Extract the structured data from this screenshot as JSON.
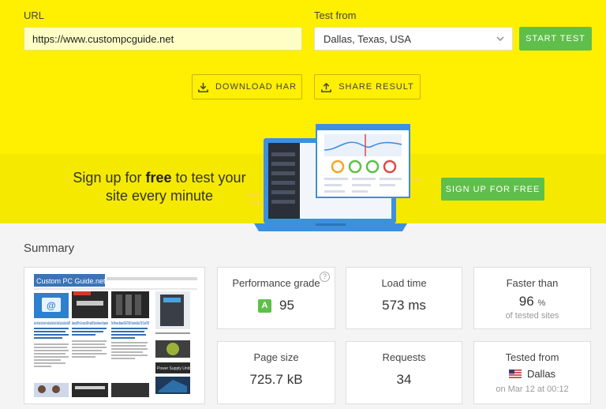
{
  "form": {
    "url_label": "URL",
    "url_value": "https://www.custompcguide.net",
    "test_from_label": "Test from",
    "test_from_value": "Dallas, Texas, USA",
    "start_label": "START TEST",
    "download_label": "DOWNLOAD HAR",
    "share_label": "SHARE RESULT"
  },
  "banner": {
    "text_before": "Sign up for ",
    "text_bold": "free",
    "text_after": " to test your site every minute",
    "button_label": "SIGN UP FOR FREE"
  },
  "summary": {
    "title": "Summary",
    "thumbnail": {
      "site_title": "Custom PC Guide.net",
      "headline_1": "Setup Your Own Domain's Email Accounts for Free via Mailgun and Email Forward for Cloudflare, Digital Ocean, SendGrid and Gmail SMTP",
      "headline_2": "Samsung 960 Pro / Evo versus 950 Pro and 850 Series Review and Comparison",
      "headline_3": "The Differences Between EVGA GTX 960 / Founders Edition, FTW, SC and FTW2",
      "sidebar_label": "Power Supply Units"
    },
    "cards": {
      "grade": {
        "title": "Performance grade",
        "letter": "A",
        "value": "95",
        "help": "?"
      },
      "load": {
        "title": "Load time",
        "value": "573 ms"
      },
      "faster": {
        "title": "Faster than",
        "value": "96",
        "unit": "%",
        "sub": "of tested sites"
      },
      "size": {
        "title": "Page size",
        "value": "725.7 kB"
      },
      "requests": {
        "title": "Requests",
        "value": "34"
      },
      "tested": {
        "title": "Tested from",
        "value": "Dallas",
        "sub": "on Mar 12 at 00:12"
      }
    }
  },
  "icons": {
    "download": "download-icon",
    "share": "share-icon",
    "chevron": "chevron-down-icon",
    "flag": "us-flag-icon"
  },
  "colors": {
    "accent": "#ffef00",
    "banner": "#f5e900",
    "green": "#5fbf4a",
    "laptop": "#3d8fe0"
  }
}
